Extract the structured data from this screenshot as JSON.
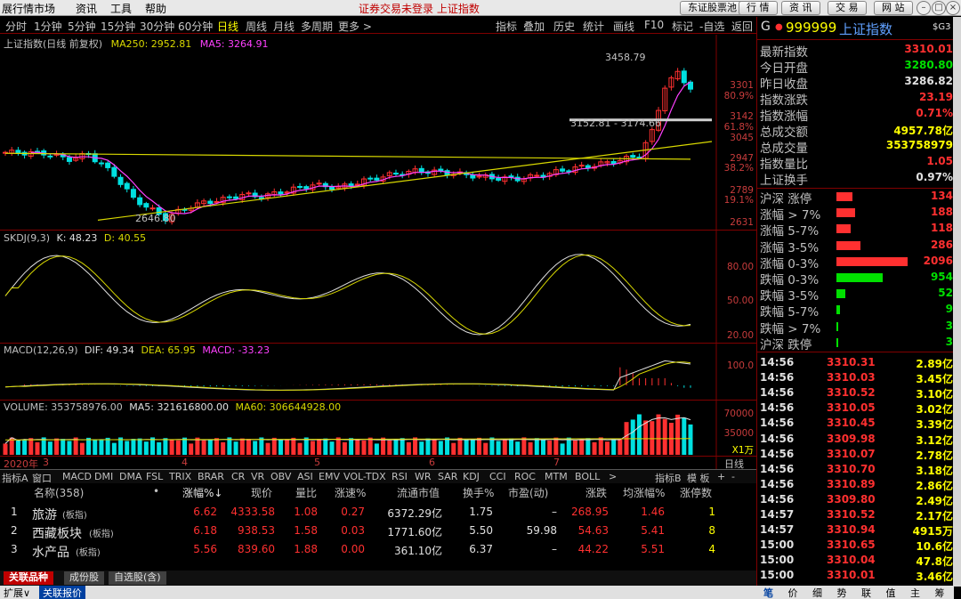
{
  "menubar": {
    "items": [
      "展行情市场",
      "资讯",
      "工具",
      "帮助"
    ],
    "notice": "证券交易未登录  上证指数",
    "buttons": [
      "东证股票池",
      "行 情",
      "资 讯",
      "交 易",
      "网 站"
    ],
    "window_controls": [
      "–",
      "□",
      "×"
    ]
  },
  "periods": [
    "分时",
    "1分钟",
    "5分钟",
    "15分钟",
    "30分钟",
    "60分钟",
    "日线",
    "周线",
    "月线",
    "多周期",
    "更多 >"
  ],
  "active_period": "日线",
  "tools": [
    "指标",
    "叠加",
    "历史",
    "统计",
    "画线",
    "F10",
    "标记",
    "-自选",
    "返回"
  ],
  "main_panel": {
    "title": "上证指数(日线 前复权)",
    "ma250": "MA250: 2952.81",
    "ma5": "MA5: 3264.91",
    "y_labels": [
      "3301",
      "80.9%",
      "3142",
      "61.8%",
      "3045",
      "2947",
      "38.2%",
      "2789",
      "19.1%",
      "2631"
    ],
    "high_label": "3458.79",
    "low_label": "2646.80",
    "range_label": "3152.81 - 3174.66"
  },
  "skdj_panel": {
    "title": "SKDJ(9,3)",
    "k": "K: 48.23",
    "d": "D: 40.55",
    "y_labels": [
      "80.00",
      "50.00",
      "20.00"
    ]
  },
  "macd_panel": {
    "title": "MACD(12,26,9)",
    "dif": "DIF: 49.34",
    "dea": "DEA: 65.95",
    "macd": "MACD: -33.23",
    "y_labels": [
      "100.0"
    ]
  },
  "volume_panel": {
    "title": "VOLUME: 353758976.00",
    "ma5": "MA5: 321616800.00",
    "ma60": "MA60: 306644928.00",
    "y_labels": [
      "70000",
      "35000",
      "X1万"
    ]
  },
  "date_axis": {
    "labels": [
      "2020年",
      "3",
      "4",
      "5",
      "6",
      "7"
    ],
    "right_label": "日线"
  },
  "indicator_tabs": [
    "指标A",
    "窗口",
    "MACD",
    "DMI",
    "DMA",
    "FSL",
    "TRIX",
    "BRAR",
    "CR",
    "VR",
    "OBV",
    "ASI",
    "EMV",
    "VOL-TDX",
    "RSI",
    "WR",
    "SAR",
    "KDJ",
    "CCI",
    "ROC",
    "MTM",
    "BOLL",
    ">",
    "指标B",
    "模 板",
    "+",
    "-"
  ],
  "table": {
    "headers": [
      "名称(358)",
      "•",
      "涨幅%↓",
      "现价",
      "量比",
      "涨速%",
      "流通市值",
      "换手%",
      "市盈(动)",
      "涨跌",
      "均涨幅%",
      "涨停数"
    ],
    "rows": [
      {
        "idx": "1",
        "name": "旅游",
        "tag": "(板指)",
        "chg": "6.62",
        "price": "4333.58",
        "vr": "1.08",
        "speed": "0.27",
        "mcap": "6372.29亿",
        "turn": "1.75",
        "pe": "–",
        "diff": "268.95",
        "avg": "1.46",
        "limit": "1"
      },
      {
        "idx": "2",
        "name": "西藏板块",
        "tag": "(板指)",
        "chg": "6.18",
        "price": "938.53",
        "vr": "1.58",
        "speed": "0.03",
        "mcap": "1771.60亿",
        "turn": "5.50",
        "pe": "59.98",
        "diff": "54.63",
        "avg": "5.41",
        "limit": "8"
      },
      {
        "idx": "3",
        "name": "水产品",
        "tag": "(板指)",
        "chg": "5.56",
        "price": "839.60",
        "vr": "1.88",
        "speed": "0.00",
        "mcap": "361.10亿",
        "turn": "6.37",
        "pe": "–",
        "diff": "44.22",
        "avg": "5.51",
        "limit": "4"
      }
    ]
  },
  "bottom_tabs": [
    "关联品种",
    "成份股",
    "自选股(含)"
  ],
  "status_bar": [
    "扩展∨",
    "关联报价"
  ],
  "right_panel": {
    "code_prefix": "G",
    "code": "999999",
    "name": "上证指数",
    "badge": "$G3",
    "stats": [
      {
        "label": "最新指数",
        "value": "3310.01",
        "color": "#ff3030"
      },
      {
        "label": "今日开盘",
        "value": "3280.80",
        "color": "#00e000"
      },
      {
        "label": "昨日收盘",
        "value": "3286.82",
        "color": "#e0e0e0"
      },
      {
        "label": "指数涨跌",
        "value": "23.19",
        "color": "#ff3030"
      },
      {
        "label": "指数涨幅",
        "value": "0.71%",
        "color": "#ff3030"
      },
      {
        "label": "总成交额",
        "value": "4957.78亿",
        "color": "#ffff00"
      },
      {
        "label": "总成交量",
        "value": "353758979",
        "color": "#ffff00"
      },
      {
        "label": "指数量比",
        "value": "1.05",
        "color": "#ff3030"
      },
      {
        "label": "上证换手",
        "value": "0.97%",
        "color": "#e0e0e0"
      }
    ],
    "breadth": [
      {
        "label": "沪深 涨停",
        "value": "134",
        "count": 134,
        "color": "#ff3030"
      },
      {
        "label": "涨幅 > 7%",
        "value": "188",
        "count": 188,
        "color": "#ff3030"
      },
      {
        "label": "涨幅 5-7%",
        "value": "118",
        "count": 118,
        "color": "#ff3030"
      },
      {
        "label": "涨幅 3-5%",
        "value": "286",
        "count": 286,
        "color": "#ff3030"
      },
      {
        "label": "涨幅 0-3%",
        "value": "2096",
        "count": 2096,
        "color": "#ff3030"
      },
      {
        "label": "跌幅 0-3%",
        "value": "954",
        "count": 954,
        "color": "#00e000"
      },
      {
        "label": "跌幅 3-5%",
        "value": "52",
        "count": 52,
        "color": "#00e000"
      },
      {
        "label": "跌幅 5-7%",
        "value": "9",
        "count": 9,
        "color": "#00e000"
      },
      {
        "label": "跌幅 > 7%",
        "value": "3",
        "count": 3,
        "color": "#00e000"
      },
      {
        "label": "沪深 跌停",
        "value": "3",
        "count": 3,
        "color": "#00e000"
      }
    ],
    "ticks": [
      {
        "time": "14:56",
        "price": "3310.31",
        "vol": "2.89亿"
      },
      {
        "time": "14:56",
        "price": "3310.03",
        "vol": "3.45亿"
      },
      {
        "time": "14:56",
        "price": "3310.52",
        "vol": "3.10亿"
      },
      {
        "time": "14:56",
        "price": "3310.05",
        "vol": "3.02亿"
      },
      {
        "time": "14:56",
        "price": "3310.45",
        "vol": "3.39亿"
      },
      {
        "time": "14:56",
        "price": "3309.98",
        "vol": "3.12亿"
      },
      {
        "time": "14:56",
        "price": "3310.07",
        "vol": "2.78亿"
      },
      {
        "time": "14:56",
        "price": "3310.70",
        "vol": "3.18亿"
      },
      {
        "time": "14:56",
        "price": "3310.89",
        "vol": "2.86亿"
      },
      {
        "time": "14:56",
        "price": "3309.80",
        "vol": "2.49亿"
      },
      {
        "time": "14:57",
        "price": "3310.52",
        "vol": "2.17亿"
      },
      {
        "time": "14:57",
        "price": "3310.94",
        "vol": "4915万"
      },
      {
        "time": "15:00",
        "price": "3310.65",
        "vol": "10.6亿"
      },
      {
        "time": "15:00",
        "price": "3310.04",
        "vol": "47.8亿"
      },
      {
        "time": "15:00",
        "price": "3310.01",
        "vol": "3.46亿"
      }
    ],
    "bottom_tabs": [
      "笔",
      "价",
      "细",
      "势",
      "联",
      "值",
      "主",
      "筹"
    ]
  },
  "colors": {
    "up": "#ff3030",
    "down": "#00e0e0",
    "ma5": "#ff40ff",
    "ma250": "#d8d800",
    "grid": "#800000"
  }
}
